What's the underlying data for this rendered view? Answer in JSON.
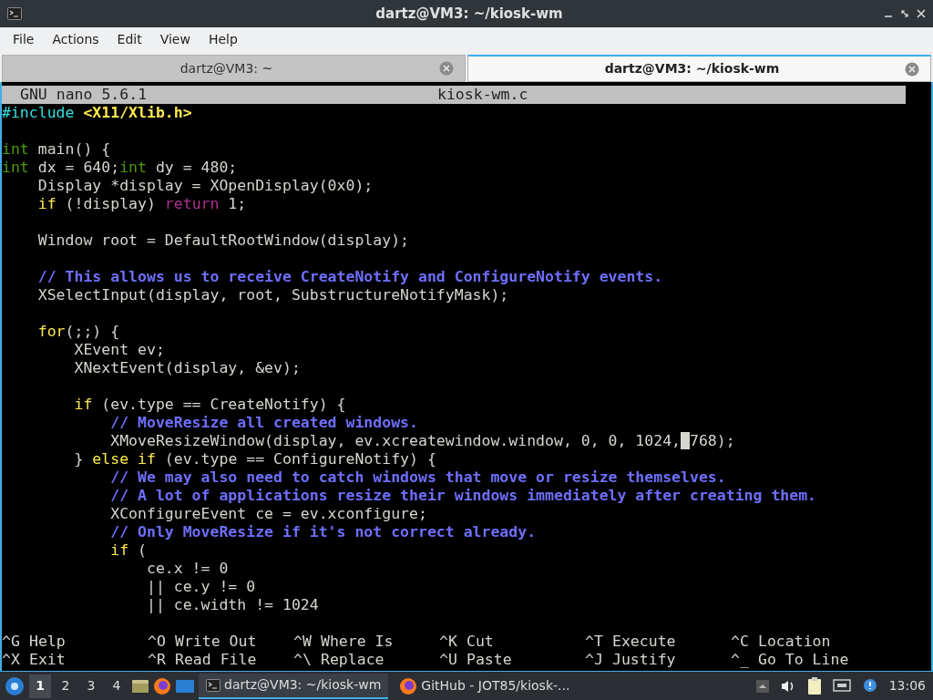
{
  "window": {
    "title": "dartz@VM3: ~/kiosk-wm"
  },
  "menu": [
    "File",
    "Actions",
    "Edit",
    "View",
    "Help"
  ],
  "tabs": [
    {
      "label": "dartz@VM3: ~",
      "selected": false
    },
    {
      "label": "dartz@VM3: ~/kiosk-wm",
      "selected": true
    }
  ],
  "nano": {
    "version": "GNU nano 5.6.1",
    "filename": "kiosk-wm.c"
  },
  "lines": [
    {
      "gap_before": false,
      "segments": [
        {
          "kind": "preproc",
          "text": "#include"
        },
        {
          "kind": "header",
          "text": " <X11/Xlib.h>"
        }
      ]
    },
    {
      "gap_before": true,
      "segments": [
        {
          "kind": "type",
          "text": "int"
        },
        {
          "kind": "plain",
          "text": " main() {"
        }
      ]
    },
    {
      "gap_before": false,
      "segments": [
        {
          "kind": "type",
          "text": "int"
        },
        {
          "kind": "plain",
          "text": " dx = 640;"
        },
        {
          "kind": "type",
          "text": "int"
        },
        {
          "kind": "plain",
          "text": " dy = 480;"
        }
      ]
    },
    {
      "gap_before": false,
      "segments": [
        {
          "kind": "plain",
          "text": "    Display *display = XOpenDisplay(0x0);"
        }
      ]
    },
    {
      "gap_before": false,
      "segments": [
        {
          "kind": "keyword",
          "text": "    if"
        },
        {
          "kind": "plain",
          "text": " (!display) "
        },
        {
          "kind": "flow",
          "text": "return"
        },
        {
          "kind": "plain",
          "text": " 1;"
        }
      ]
    },
    {
      "gap_before": true,
      "segments": [
        {
          "kind": "plain",
          "text": "    Window root = DefaultRootWindow(display);"
        }
      ]
    },
    {
      "gap_before": true,
      "segments": [
        {
          "kind": "comment",
          "text": "    // This allows us to receive CreateNotify and ConfigureNotify events."
        }
      ]
    },
    {
      "gap_before": false,
      "segments": [
        {
          "kind": "plain",
          "text": "    XSelectInput(display, root, SubstructureNotifyMask);"
        }
      ]
    },
    {
      "gap_before": true,
      "segments": [
        {
          "kind": "keyword",
          "text": "    for"
        },
        {
          "kind": "plain",
          "text": "(;;) {"
        }
      ]
    },
    {
      "gap_before": false,
      "segments": [
        {
          "kind": "plain",
          "text": "        XEvent ev;"
        }
      ]
    },
    {
      "gap_before": false,
      "segments": [
        {
          "kind": "plain",
          "text": "        XNextEvent(display, &ev);"
        }
      ]
    },
    {
      "gap_before": true,
      "segments": [
        {
          "kind": "keyword",
          "text": "        if"
        },
        {
          "kind": "plain",
          "text": " (ev.type == CreateNotify) {"
        }
      ]
    },
    {
      "gap_before": false,
      "segments": [
        {
          "kind": "comment",
          "text": "            // MoveResize all created windows."
        }
      ]
    },
    {
      "gap_before": false,
      "segments": [
        {
          "kind": "plain",
          "text": "            XMoveResizeWindow(display, ev.xcreatewindow.window, 0, 0, 1024,"
        },
        {
          "kind": "plain",
          "text": " 768);",
          "cursor": true
        }
      ]
    },
    {
      "gap_before": false,
      "segments": [
        {
          "kind": "plain",
          "text": "        } "
        },
        {
          "kind": "keyword",
          "text": "else"
        },
        {
          "kind": "keyword",
          "text": " if"
        },
        {
          "kind": "plain",
          "text": " (ev.type == ConfigureNotify) {"
        }
      ]
    },
    {
      "gap_before": false,
      "segments": [
        {
          "kind": "comment",
          "text": "            // We may also need to catch windows that move or resize themselves."
        }
      ]
    },
    {
      "gap_before": false,
      "segments": [
        {
          "kind": "comment",
          "text": "            // A lot of applications resize their windows immediately after creating them."
        }
      ]
    },
    {
      "gap_before": false,
      "segments": [
        {
          "kind": "plain",
          "text": "            XConfigureEvent ce = ev.xconfigure;"
        }
      ]
    },
    {
      "gap_before": false,
      "segments": [
        {
          "kind": "comment",
          "text": "            // Only MoveResize if it's not correct already."
        }
      ]
    },
    {
      "gap_before": false,
      "segments": [
        {
          "kind": "keyword",
          "text": "            if"
        },
        {
          "kind": "plain",
          "text": " ("
        }
      ]
    },
    {
      "gap_before": false,
      "segments": [
        {
          "kind": "plain",
          "text": "                ce.x != 0"
        }
      ]
    },
    {
      "gap_before": false,
      "segments": [
        {
          "kind": "plain",
          "text": "                || ce.y != 0"
        }
      ]
    },
    {
      "gap_before": false,
      "segments": [
        {
          "kind": "plain",
          "text": "                || ce.width != 1024"
        }
      ]
    }
  ],
  "shortcuts": [
    [
      {
        "key": "^G",
        "label": "Help"
      },
      {
        "key": "^X",
        "label": "Exit"
      }
    ],
    [
      {
        "key": "^O",
        "label": "Write Out"
      },
      {
        "key": "^R",
        "label": "Read File"
      }
    ],
    [
      {
        "key": "^W",
        "label": "Where Is"
      },
      {
        "key": "^\\",
        "label": "Replace"
      }
    ],
    [
      {
        "key": "^K",
        "label": "Cut"
      },
      {
        "key": "^U",
        "label": "Paste"
      }
    ],
    [
      {
        "key": "^T",
        "label": "Execute"
      },
      {
        "key": "^J",
        "label": "Justify"
      }
    ],
    [
      {
        "key": "^C",
        "label": "Location"
      },
      {
        "key": "^_",
        "label": "Go To Line"
      }
    ]
  ],
  "taskbar": {
    "desktops": [
      {
        "label": "1",
        "selected": true
      },
      {
        "label": "2",
        "selected": false
      },
      {
        "label": "3",
        "selected": false
      },
      {
        "label": "4",
        "selected": false
      }
    ],
    "tasks": [
      {
        "kind": "terminal",
        "label": "dartz@VM3: ~/kiosk-wm",
        "selected": true
      },
      {
        "kind": "browser",
        "label": "GitHub - JOT85/kiosk-...",
        "selected": false
      }
    ],
    "clock": "13:06"
  }
}
